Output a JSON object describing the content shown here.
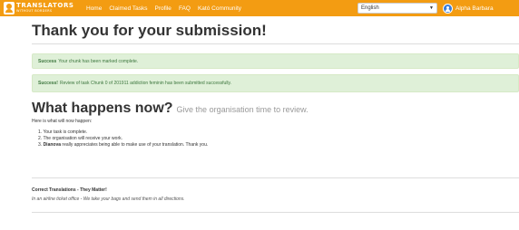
{
  "navbar": {
    "logo_main": "TRANSLATORS",
    "logo_sub": "WITHOUT BORDERS",
    "links": [
      "Home",
      "Claimed Tasks",
      "Profile",
      "FAQ",
      "Kató Community"
    ],
    "language_select": "English",
    "user_name": "Alpha Barbara",
    "color": "#f39c12"
  },
  "page_title": "Thank you for your submission!",
  "alerts": [
    {
      "strong": "Success",
      "text": "Your chunk has been marked complete."
    },
    {
      "strong": "Success!",
      "text": "Review of task Chunk 0 of 201911 addiction feminin has been submitted successfully."
    }
  ],
  "next": {
    "title": "What happens now?",
    "subtitle": "Give the organisation time to review.",
    "intro": "Here is what will now happen:",
    "steps": [
      "1. Your task is complete.",
      "2. The organisation will receive your work."
    ],
    "step3_number": "3.",
    "step3_org": "Dianova",
    "step3_text": "really appreciates being able to make use of your translation. Thank you."
  },
  "footer": {
    "title": "Correct Translations - They Matter!",
    "quote": "In an airline ticket office - We take your bags and send them in all directions."
  }
}
